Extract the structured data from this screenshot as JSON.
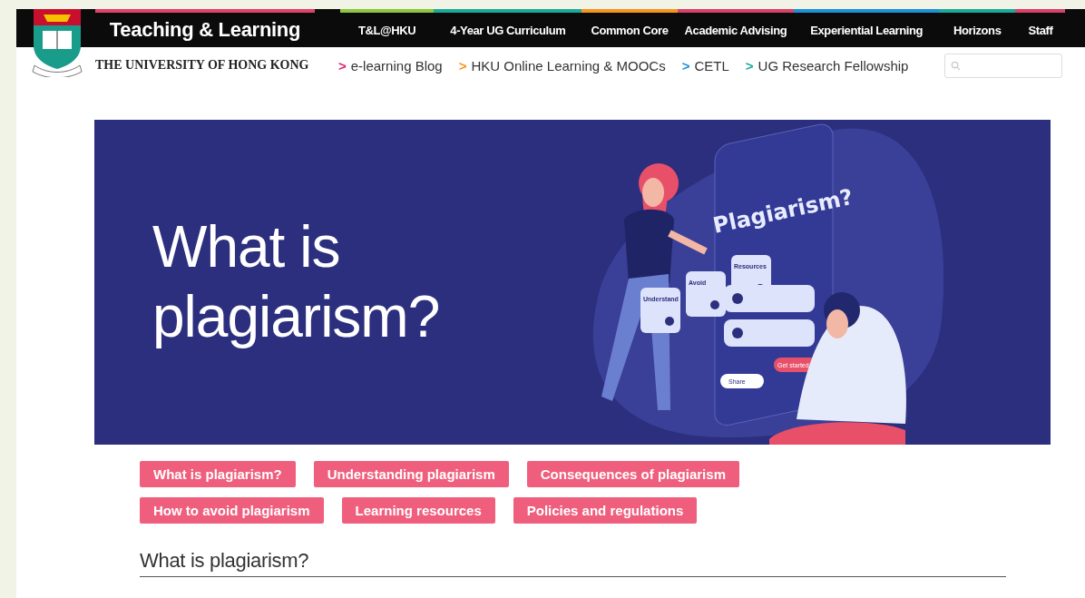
{
  "header": {
    "site_title": "Teaching & Learning",
    "university": "THE UNIVERSITY OF HONG KONG",
    "nav": [
      {
        "label": "T&L@HKU",
        "color": "#8dc63f"
      },
      {
        "label": "4-Year UG Curriculum",
        "color": "#1aa99a"
      },
      {
        "label": "Common Core",
        "color": "#f7941d"
      },
      {
        "label": "Academic Advising",
        "color": "#d9416a"
      },
      {
        "label": "Experiential Learning",
        "color": "#1e90d8"
      },
      {
        "label": "Horizons",
        "color": "#1aa99a"
      },
      {
        "label": "Staff",
        "color": "#d9416a"
      }
    ],
    "links": [
      {
        "marker": ">",
        "label": "e-learning Blog",
        "color": "#e0216e"
      },
      {
        "marker": ">",
        "label": "HKU Online Learning & MOOCs",
        "color": "#f7941d"
      },
      {
        "marker": ">",
        "label": "CETL",
        "color": "#1e90d8"
      },
      {
        "marker": ">",
        "label": "UG Research Fellowship",
        "color": "#1aa99a"
      }
    ]
  },
  "banner": {
    "title": "What is plagiarism?",
    "phone_title": "Plagiarism?",
    "cards": [
      "Understand",
      "Avoid",
      "Resources"
    ],
    "share": "Share",
    "start": "Get started"
  },
  "topics": [
    [
      "What is plagiarism?",
      "Understanding plagiarism",
      "Consequences of plagiarism"
    ],
    [
      "How to avoid plagiarism",
      "Learning resources",
      "Policies and regulations"
    ]
  ],
  "section_heading": "What is plagiarism?"
}
